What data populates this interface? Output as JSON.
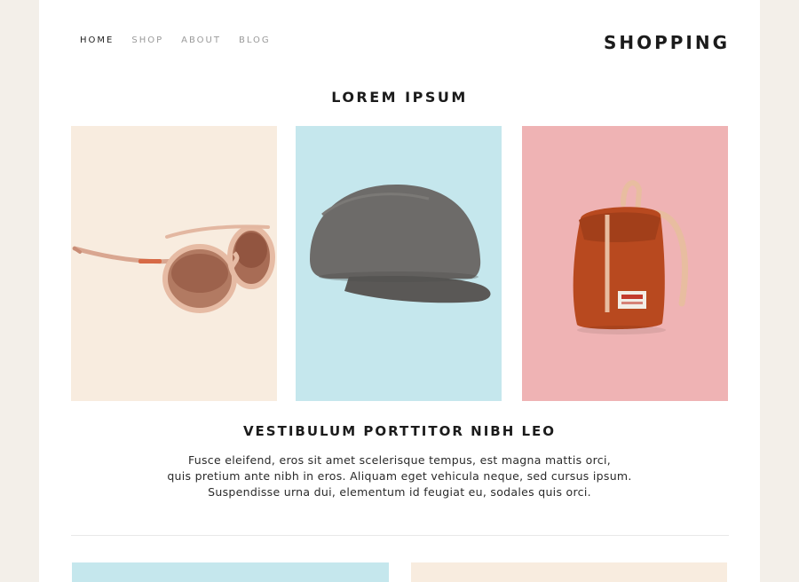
{
  "nav": {
    "items": [
      {
        "label": "HOME",
        "active": true
      },
      {
        "label": "SHOP",
        "active": false
      },
      {
        "label": "ABOUT",
        "active": false
      },
      {
        "label": "BLOG",
        "active": false
      }
    ]
  },
  "brand": {
    "title": "SHOPPING"
  },
  "section": {
    "title": "LOREM IPSUM"
  },
  "products": [
    {
      "icon": "sunglasses-icon",
      "bg_color": "#f8ecdf"
    },
    {
      "icon": "cap-icon",
      "bg_color": "#c5e7ed"
    },
    {
      "icon": "backpack-icon",
      "bg_color": "#efb3b4"
    }
  ],
  "feature": {
    "title": "VESTIBULUM PORTTITOR NIBH LEO",
    "lines": [
      "Fusce eleifend, eros sit amet scelerisque tempus, est magna mattis orci,",
      "quis pretium ante nibh in eros. Aliquam eget vehicula neque, sed cursus ipsum.",
      "Suspendisse urna dui, elementum id feugiat eu, sodales quis orci."
    ]
  },
  "bottom_tiles": [
    {
      "bg_color": "#c5e7ed"
    },
    {
      "bg_color": "#f8ecdf"
    }
  ],
  "colors": {
    "page_bg": "#f3efe9",
    "text": "#1b1b1b",
    "nav_inactive": "#9a9a9a"
  }
}
